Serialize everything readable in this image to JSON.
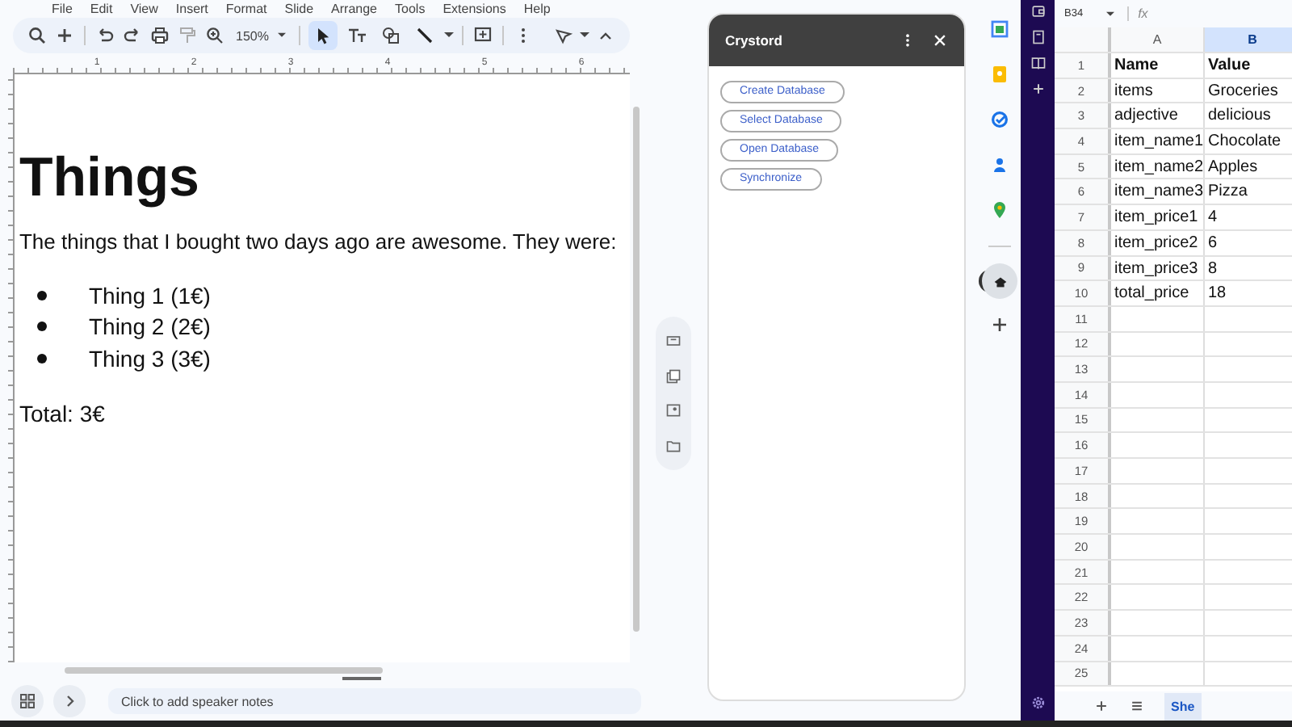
{
  "menu": [
    "File",
    "Edit",
    "View",
    "Insert",
    "Format",
    "Slide",
    "Arrange",
    "Tools",
    "Extensions",
    "Help"
  ],
  "toolbar": {
    "zoom": "150%",
    "tools": [
      {
        "kind": "pointer",
        "selected": true
      },
      {
        "kind": "text",
        "selected": false
      },
      {
        "kind": "shape",
        "selected": false
      },
      {
        "kind": "line",
        "selected": false
      }
    ]
  },
  "ruler": {
    "marks": [
      "1",
      "2",
      "3",
      "4",
      "5",
      "6"
    ]
  },
  "slide": {
    "title": "Things",
    "paragraph": "The things that I bought two days ago are awesome. They were:",
    "bullets": [
      "Thing 1 (1€)",
      "Thing 2 (2€)",
      "Thing 3 (3€)"
    ],
    "total": "Total: 3€"
  },
  "speaker_notes": {
    "placeholder": "Click to add speaker notes"
  },
  "addon": {
    "title": "Crystord",
    "buttons": [
      "Create Database",
      "Select Database",
      "Open Database",
      "Synchronize"
    ]
  },
  "sheet": {
    "name_box": "B34",
    "formula_label": "fx",
    "columns": [
      {
        "label": "A",
        "selected": false
      },
      {
        "label": "B",
        "selected": true
      }
    ],
    "rows": [
      {
        "number": "1",
        "cells": [
          "Name",
          "Value"
        ],
        "bold": true
      },
      {
        "number": "2",
        "cells": [
          "items",
          "Groceries"
        ],
        "bold": false
      },
      {
        "number": "3",
        "cells": [
          "adjective",
          "delicious"
        ],
        "bold": false
      },
      {
        "number": "4",
        "cells": [
          "item_name1",
          "Chocolate"
        ],
        "bold": false
      },
      {
        "number": "5",
        "cells": [
          "item_name2",
          "Apples"
        ],
        "bold": false
      },
      {
        "number": "6",
        "cells": [
          "item_name3",
          "Pizza"
        ],
        "bold": false
      },
      {
        "number": "7",
        "cells": [
          "item_price1",
          "4"
        ],
        "bold": false
      },
      {
        "number": "8",
        "cells": [
          "item_price2",
          "6"
        ],
        "bold": false
      },
      {
        "number": "9",
        "cells": [
          "item_price3",
          "8"
        ],
        "bold": false
      },
      {
        "number": "10",
        "cells": [
          "total_price",
          "18"
        ],
        "bold": false
      },
      {
        "number": "11"
      },
      {
        "number": "12"
      },
      {
        "number": "13"
      },
      {
        "number": "14"
      },
      {
        "number": "15"
      },
      {
        "number": "16"
      },
      {
        "number": "17"
      },
      {
        "number": "18"
      },
      {
        "number": "19"
      },
      {
        "number": "20"
      },
      {
        "number": "21"
      },
      {
        "number": "22"
      },
      {
        "number": "23"
      },
      {
        "number": "24"
      },
      {
        "number": "25"
      }
    ],
    "tab": "She"
  }
}
